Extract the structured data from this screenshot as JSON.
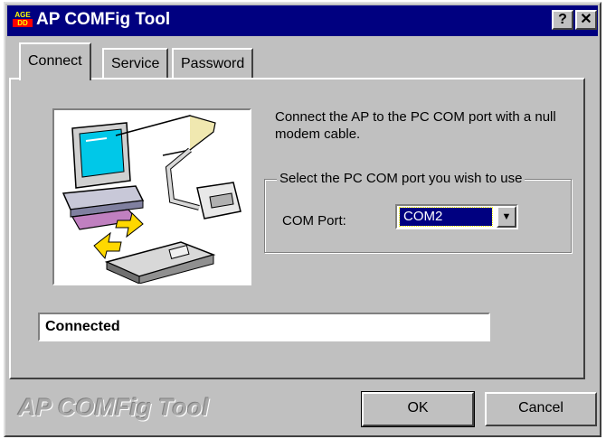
{
  "window": {
    "title": "AP COMFig Tool",
    "icon_top": "AGE",
    "icon_bottom": "DD",
    "help_label": "?",
    "close_label": "✕"
  },
  "tabs": [
    {
      "label": "Connect",
      "active": true
    },
    {
      "label": "Service",
      "active": false
    },
    {
      "label": "Password",
      "active": false
    }
  ],
  "connect": {
    "description": "Connect the AP to the PC COM port with a null modem cable.",
    "group_label": "Select the PC COM port you wish to use",
    "com_port_label": "COM Port:",
    "com_port_value": "COM2",
    "dropdown_icon": "▼",
    "status_text": "Connected"
  },
  "footer": {
    "brand_text": "AP COMFig Tool",
    "ok_label": "OK",
    "cancel_label": "Cancel"
  },
  "colors": {
    "titlebar": "#000080",
    "face": "#c0c0c0",
    "selection": "#000080"
  }
}
